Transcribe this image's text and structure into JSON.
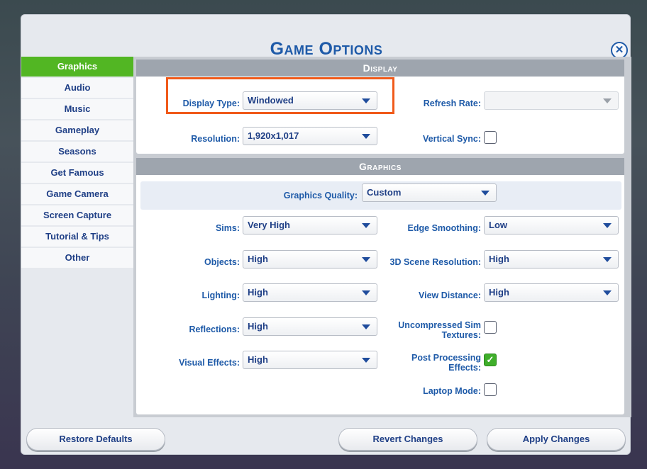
{
  "dialog": {
    "title": "Game Options",
    "close_symbol": "✕"
  },
  "sidebar": {
    "items": [
      {
        "label": "Graphics",
        "active": true
      },
      {
        "label": "Audio"
      },
      {
        "label": "Music"
      },
      {
        "label": "Gameplay"
      },
      {
        "label": "Seasons"
      },
      {
        "label": "Get Famous"
      },
      {
        "label": "Game Camera"
      },
      {
        "label": "Screen Capture"
      },
      {
        "label": "Tutorial & Tips"
      },
      {
        "label": "Other"
      }
    ]
  },
  "display": {
    "header": "Display",
    "display_type": {
      "label": "Display Type:",
      "value": "Windowed"
    },
    "refresh_rate": {
      "label": "Refresh Rate:",
      "value": ""
    },
    "resolution": {
      "label": "Resolution:",
      "value": "1,920x1,017"
    },
    "vertical_sync": {
      "label": "Vertical Sync:",
      "checked": false
    }
  },
  "graphics": {
    "header": "Graphics",
    "quality": {
      "label": "Graphics Quality:",
      "value": "Custom"
    },
    "sims": {
      "label": "Sims:",
      "value": "Very High"
    },
    "objects": {
      "label": "Objects:",
      "value": "High"
    },
    "lighting": {
      "label": "Lighting:",
      "value": "High"
    },
    "reflections": {
      "label": "Reflections:",
      "value": "High"
    },
    "visual_effects": {
      "label": "Visual Effects:",
      "value": "High"
    },
    "edge_smoothing": {
      "label": "Edge Smoothing:",
      "value": "Low"
    },
    "scene_resolution": {
      "label": "3D Scene Resolution:",
      "value": "High"
    },
    "view_distance": {
      "label": "View Distance:",
      "value": "High"
    },
    "uncompressed_textures": {
      "label_line1": "Uncompressed Sim",
      "label_line2": "Textures:",
      "checked": false
    },
    "post_processing": {
      "label_line1": "Post Processing",
      "label_line2": "Effects:",
      "checked": true,
      "check_symbol": "✓"
    },
    "laptop_mode": {
      "label": "Laptop Mode:",
      "checked": false
    }
  },
  "footer": {
    "restore": "Restore Defaults",
    "revert": "Revert Changes",
    "apply": "Apply Changes"
  },
  "colors": {
    "accent": "#1e5aa8",
    "active_tab": "#52b623",
    "highlight_box": "#f05a1a",
    "checkbox_on": "#3fae2a"
  }
}
